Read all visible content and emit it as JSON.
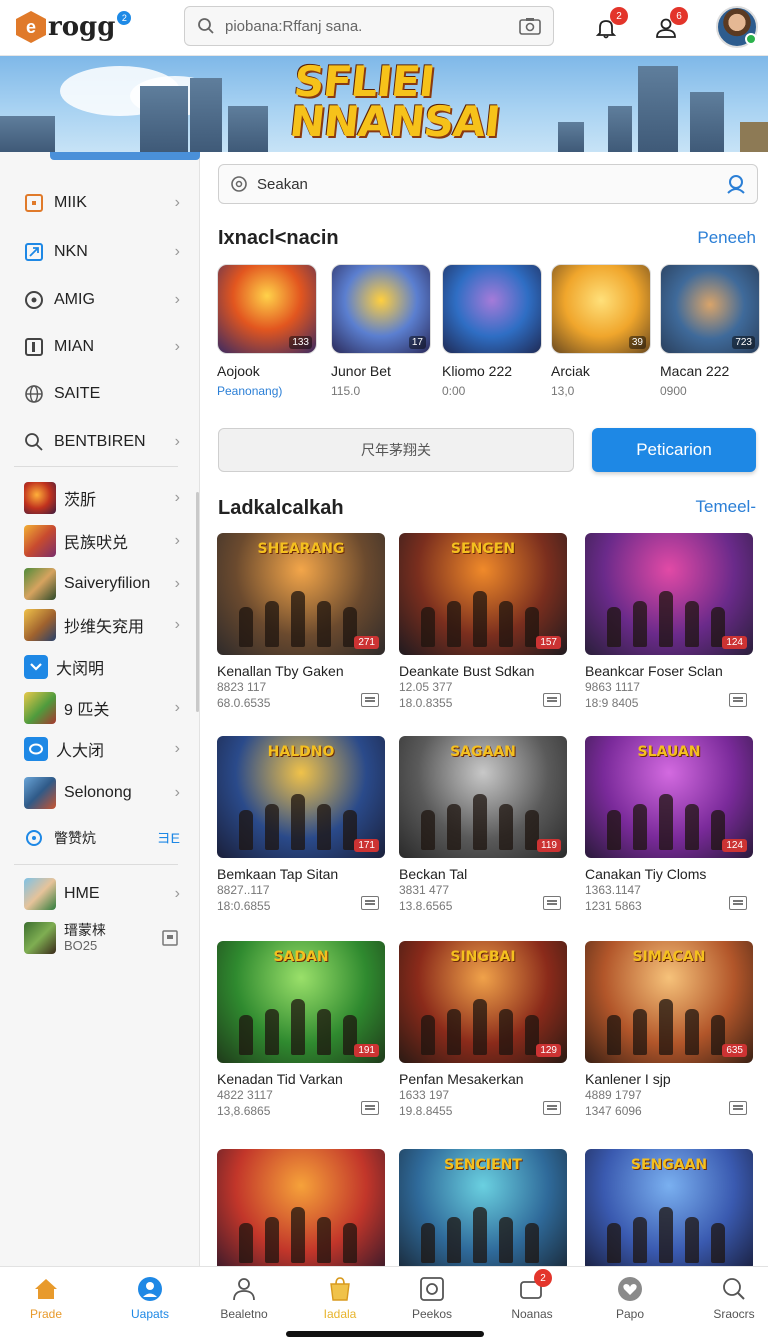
{
  "header": {
    "logo_text": "rogg",
    "logo_badge": "2",
    "search_placeholder": "piobana:Rffanj sana.",
    "notification_count": "2",
    "profile_count": "6"
  },
  "hero": {
    "title_line1": "SFLIEI",
    "title_line2": "NNANSAI"
  },
  "sidebar": {
    "items": [
      {
        "label": "MIIK",
        "icon": "square-icon"
      },
      {
        "label": "NKN",
        "icon": "arrow-box-icon"
      },
      {
        "label": "AMIG",
        "icon": "circle-icon"
      },
      {
        "label": "MIAN",
        "icon": "bookmark-icon"
      },
      {
        "label": "SAITE",
        "icon": "globe-icon"
      },
      {
        "label": "BENTBIREN",
        "icon": "search-icon"
      }
    ],
    "games": [
      {
        "label": "茨肵"
      },
      {
        "label": "民族吠兑"
      },
      {
        "label": "Saiveryfilion"
      },
      {
        "label": "抄维矢兖用"
      },
      {
        "label": "大闵明"
      },
      {
        "label": "9 匹关"
      },
      {
        "label": "人大闭"
      },
      {
        "label": "Selonong"
      }
    ],
    "section_label": "瞥赞炕",
    "section_action": "ヨE",
    "bottom_items": [
      {
        "label": "HME"
      },
      {
        "label": "瑨蒙梾",
        "sub": "BO25"
      }
    ]
  },
  "main": {
    "search_text": "Seakan",
    "section1": {
      "title": "Ixnacl<nacin",
      "link": "Peneeh"
    },
    "featured": [
      {
        "name": "Aojook",
        "sub": "Peanonang)",
        "num": "133",
        "sub_blue": true
      },
      {
        "name": "Junor Bet",
        "sub": "115.0",
        "num": "17"
      },
      {
        "name": "Kliomo 222",
        "sub": "0:00",
        "num": ""
      },
      {
        "name": "Arciak",
        "sub": "13,0",
        "num": "39"
      },
      {
        "name": "Macan 222",
        "sub": "0900",
        "num": "723"
      }
    ],
    "grey_button": "尺年茅翔关",
    "blue_button": "Peticarion",
    "section2": {
      "title": "Ladkalcalkah",
      "link": "Temeel-"
    },
    "cards": [
      {
        "title": "Kenallan Tby Gaken",
        "meta1": "8823 117",
        "meta2": "68.0.6535",
        "num": "271",
        "tag": "SHEARANG"
      },
      {
        "title": "Deankate Bust Sdkan",
        "meta1": "12.05 377",
        "meta2": "18.0.8355",
        "num": "157",
        "tag": "SENGEN"
      },
      {
        "title": "Beankcar Foser Sclan",
        "meta1": "9863 1117",
        "meta2": "18:9 8405",
        "num": "124",
        "tag": ""
      },
      {
        "title": "Bemkaan Tap Sitan",
        "meta1": "8827..117",
        "meta2": "18:0.6855",
        "num": "171",
        "tag": "HALDNO"
      },
      {
        "title": "Beckan Tal",
        "meta1": "3831 477",
        "meta2": "13.8.6565",
        "num": "119",
        "tag": "SAGAAN"
      },
      {
        "title": "Canakan Tiy Cloms",
        "meta1": "1363.1147",
        "meta2": "1231 5863",
        "num": "124",
        "tag": "SLAUAN"
      },
      {
        "title": "Kenadan Tid Varkan",
        "meta1": "4822 3117",
        "meta2": "13,8.6865",
        "num": "191",
        "tag": "SADAN"
      },
      {
        "title": "Penfan Mesakerkan",
        "meta1": "1633 197",
        "meta2": "19.8.8455",
        "num": "129",
        "tag": "SINGBAI"
      },
      {
        "title": "Kanlener I sjp",
        "meta1": "4889 1797",
        "meta2": "1347 6096",
        "num": "635",
        "tag": "SIMACAN"
      },
      {
        "title": "",
        "meta1": "",
        "meta2": "",
        "num": "",
        "tag": ""
      },
      {
        "title": "",
        "meta1": "",
        "meta2": "",
        "num": "",
        "tag": "SENCIENT"
      },
      {
        "title": "",
        "meta1": "",
        "meta2": "",
        "num": "",
        "tag": "SENGAAN"
      }
    ]
  },
  "bottom_nav": [
    {
      "label": "Prade",
      "icon": "home-icon",
      "color": "#e89a2c"
    },
    {
      "label": "Uapats",
      "icon": "user-circle-icon",
      "color": "#1e88e5"
    },
    {
      "label": "Bealetno",
      "icon": "person-icon",
      "color": "#555"
    },
    {
      "label": "Iadala",
      "icon": "bag-icon",
      "color": "#e8b42c"
    },
    {
      "label": "Peekos",
      "icon": "camera-icon",
      "color": "#555"
    },
    {
      "label": "Noanas",
      "icon": "chat-icon",
      "color": "#555",
      "badge": "2"
    },
    {
      "label": "Papo",
      "icon": "heart-icon",
      "color": "#555"
    },
    {
      "label": "Sraocrs",
      "icon": "search-icon",
      "color": "#555"
    }
  ],
  "colors": {
    "accent": "#1e88e5",
    "link": "#2b7fd6",
    "badge": "#e3352b",
    "brand": "#e07a2a"
  }
}
